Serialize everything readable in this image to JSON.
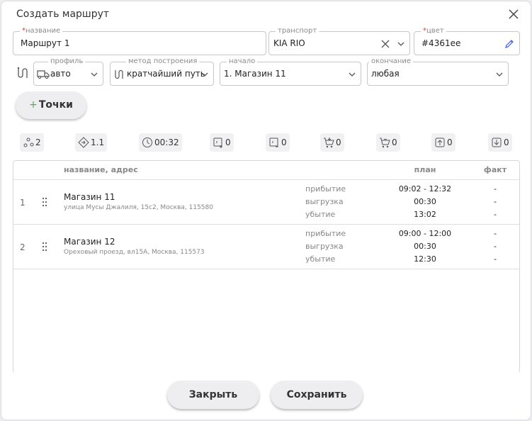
{
  "dialog": {
    "title": "Создать маршрут"
  },
  "form": {
    "name": {
      "label": "название",
      "value": "Маршрут 1",
      "required": true
    },
    "transport": {
      "label": "транспорт",
      "value": "KIA RIO"
    },
    "color": {
      "label": "цвет",
      "value": "#4361ee",
      "required": true
    },
    "profile": {
      "label": "профиль",
      "value": "авто"
    },
    "method": {
      "label": "метод построения",
      "value": "кратчайший путь"
    },
    "start": {
      "label": "начало",
      "value": "1. Магазин 11"
    },
    "end": {
      "label": "окончание",
      "value": "любая"
    }
  },
  "add_points_button": {
    "plus": "+",
    "label": "Точки"
  },
  "stats": [
    {
      "icon": "points-icon",
      "value": "2"
    },
    {
      "icon": "distance-icon",
      "value": "1.1"
    },
    {
      "icon": "clock-icon",
      "value": "00:32"
    },
    {
      "icon": "load-plus-icon",
      "value": "0"
    },
    {
      "icon": "load-minus-icon",
      "value": "0"
    },
    {
      "icon": "cart-plus-icon",
      "value": "0"
    },
    {
      "icon": "cart-minus-icon",
      "value": "0"
    },
    {
      "icon": "box-up-icon",
      "value": "0"
    },
    {
      "icon": "box-down-icon",
      "value": "0"
    }
  ],
  "table": {
    "headers": {
      "name": "название, адрес",
      "plan": "план",
      "fact": "факт"
    },
    "rows": [
      {
        "num": "1",
        "name": "Магазин 11",
        "address": "улица Мусы Джалиля, 15с2, Москва, 115580",
        "events": [
          "прибытие",
          "выгрузка",
          "убытие"
        ],
        "plan": [
          "09:02 - 12:32",
          "00:30",
          "13:02"
        ],
        "fact": [
          "-",
          "-",
          "-"
        ]
      },
      {
        "num": "2",
        "name": "Магазин 12",
        "address": "Ореховый проезд, вл15А, Москва, 115573",
        "events": [
          "прибытие",
          "выгрузка",
          "убытие"
        ],
        "plan": [
          "09:00 - 12:00",
          "00:30",
          "12:30"
        ],
        "fact": [
          "-",
          "-",
          "-"
        ]
      }
    ]
  },
  "footer": {
    "close_label": "Закрыть",
    "save_label": "Сохранить"
  },
  "colors": {
    "accent": "#4361ee",
    "required": "#e0363b",
    "plus": "#4caf50"
  }
}
